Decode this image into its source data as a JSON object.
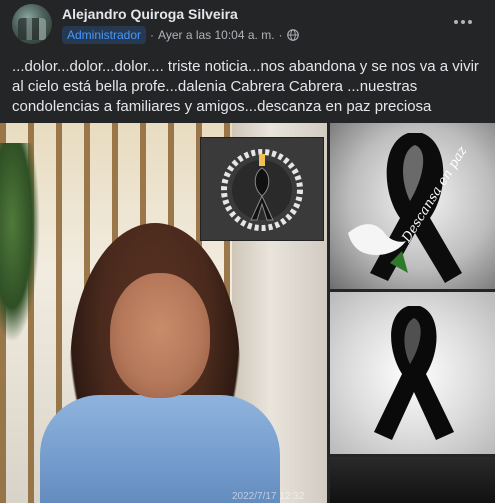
{
  "post": {
    "author": "Alejandro Quiroga Silveira",
    "badge": "Administrador",
    "separator": "·",
    "time": "Ayer a las 10:04 a. m.",
    "more_label": "···",
    "text_lines": [
      "...dolor...dolor...dolor.... triste noticia...nos abandona y se nos va a vivir",
      "al cielo está bella profe...dalenia Cabrera Cabrera ...nuestras",
      "condolencias a familiares y amigos...descanza en paz preciosa"
    ]
  },
  "photos": {
    "ribbon_text": "Descansa en paz",
    "photo_timestamp": "2022/7/17  12:32"
  },
  "icons": {
    "globe": "globe-icon",
    "more": "more-options-icon"
  },
  "colors": {
    "background": "#242526",
    "badge_bg": "#263951",
    "badge_text": "#4599ff",
    "primary_text": "#e4e6eb",
    "secondary_text": "#b0b3b8"
  }
}
